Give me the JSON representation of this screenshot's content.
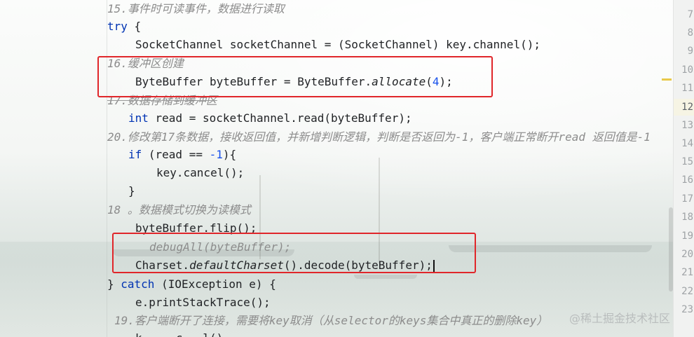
{
  "editor": {
    "lines": {
      "c15": "15.事件时可读事件，数据进行读取",
      "try_kw": "try",
      "try_rest": " {",
      "sc_decl": "SocketChannel socketChannel = (SocketChannel) key.channel();",
      "c16": "16.缓冲区创建",
      "bb_prefix": "ByteBuffer byteBuffer = ByteBuffer.",
      "bb_method": "allocate",
      "bb_open": "(",
      "bb_num": "4",
      "bb_close": ");",
      "c17": "17.数据存储到缓冲区",
      "read_kw": "int",
      "read_rest": " read = socketChannel.read(byteBuffer);",
      "c20": "20.修改第17条数据，接收返回值，并新增判断逻辑，判断是否返回为-1，客户端正常断开read 返回值是-1",
      "if_kw": "if",
      "if_a": " (read == ",
      "if_num": "-1",
      "if_b": "){",
      "cancel": "key.cancel();",
      "brace": "}",
      "c18": "18 。数据模式切换为读模式",
      "flip": "byteBuffer.flip();",
      "debug": "debugAll(byteBuffer);",
      "cs_a": "Charset.",
      "cs_method": "defaultCharset",
      "cs_b": "().decode(byteBuffer);",
      "catch_a": "} ",
      "catch_kw": "catch",
      "catch_b": " (IOException e) {",
      "trace": "e.printStackTrace();",
      "c19": "19.客户端断开了连接，需要将key取消（从selector的keys集合中真正的删除key）",
      "partial": "k     c   l()"
    },
    "line_numbers": [
      "7",
      "8",
      "9",
      "10",
      "11",
      "12",
      "13",
      "14",
      "15",
      "16",
      "17",
      "18",
      "19",
      "20",
      "21",
      "22",
      "23"
    ],
    "current_line": "12",
    "top_partial_number": "7"
  },
  "watermark": "@稀土掘金技术社区",
  "colors": {
    "keyword": "#0033b3",
    "number": "#1750eb",
    "comment": "#8c8c8c",
    "highlight_box": "#e0262a"
  }
}
